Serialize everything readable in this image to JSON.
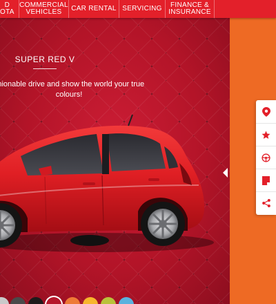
{
  "nav": {
    "items": [
      {
        "line1": "D",
        "line2": "OTA"
      },
      {
        "line1": "COMMERCIAL",
        "line2": "VEHICLES"
      },
      {
        "line1": "CAR RENTAL",
        "line2": ""
      },
      {
        "line1": "SERVICING",
        "line2": ""
      },
      {
        "line1": "FINANCE &",
        "line2": "INSURANCE"
      }
    ]
  },
  "hero": {
    "color_name": "SUPER RED V",
    "tagline_1": "shionable drive and show the world your true",
    "tagline_2": "colours!"
  },
  "swatches": [
    {
      "name": "silver",
      "color": "#c9c9c9"
    },
    {
      "name": "dark-grey",
      "color": "#4a4a4a"
    },
    {
      "name": "black",
      "color": "#1e1b1b"
    },
    {
      "name": "super-red",
      "color": "#b5172b",
      "selected": true
    },
    {
      "name": "orange",
      "color": "#ee7a36"
    },
    {
      "name": "yellow",
      "color": "#f7b62c"
    },
    {
      "name": "lime",
      "color": "#b9c23a"
    },
    {
      "name": "sky-blue",
      "color": "#5ab2de"
    }
  ],
  "sidebar": {
    "icons": [
      "location-pin-icon",
      "star-icon",
      "steering-wheel-icon",
      "brochure-icon",
      "share-icon"
    ],
    "accent": "#e3202a"
  },
  "colors": {
    "nav": "#e3202a",
    "panel": "#ee6a24",
    "stage": "#b8142a"
  }
}
